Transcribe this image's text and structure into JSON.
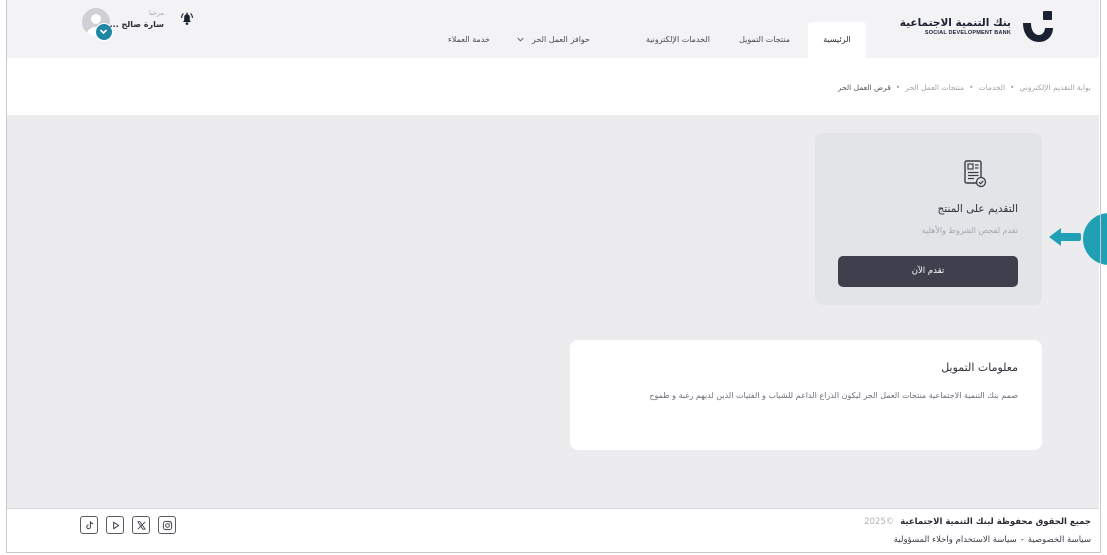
{
  "header": {
    "logo": {
      "title": "بنك التنمية الاجتماعية",
      "subtitle": "SOCIAL DEVELOPMENT BANK",
      "icon": "sdb-logo-icon"
    },
    "nav": [
      {
        "label": "الرئيسية",
        "active": true
      },
      {
        "label": "منتجات التمويل",
        "active": false
      },
      {
        "label": "الخدمات الإلكترونية",
        "active": false
      },
      {
        "label": "حوافز العمل الحر",
        "active": false,
        "has_dropdown": true
      },
      {
        "label": "خدمة العملاء",
        "active": false
      }
    ],
    "user": {
      "greeting": "مرحبا",
      "name": "سارة صالح ...",
      "avatar_icon": "user-avatar-icon",
      "badge_icon": "chevron-down-icon"
    },
    "notifications_icon": "bell-icon"
  },
  "breadcrumb": {
    "items": [
      "بوابة التقديم الإلكتروني",
      "الخدمات",
      "منتجات العمل الحر",
      "قرض العمل الحر"
    ],
    "separator": "•"
  },
  "apply_card": {
    "icon": "application-form-icon",
    "title": "التقديم على المنتج",
    "subtitle": "تقدم لفحص الشروط والأهلية",
    "button_label": "تقدم الآن"
  },
  "info_card": {
    "title": "معلومات التمويل",
    "body": "صمم بنك التنمية الاجتماعية منتجات العمل الحر ليكون الذراع الداعم للشباب و الفتيات الذين لديهم رغبة و طموح"
  },
  "footer": {
    "copyright": "جميع الحقوق محفوظة لبنك التنمية الاجتماعية",
    "year": "2025©",
    "policy_links": [
      "سياسة الخصوصية",
      "سياسة الاستخدام واخلاء المسؤولية"
    ],
    "policy_separator": "-",
    "social": [
      "tiktok-icon",
      "youtube-icon",
      "x-icon",
      "instagram-icon"
    ]
  },
  "annotation": {
    "icon": "arrow-left-icon",
    "color": "#1fa0b5"
  },
  "colors": {
    "header_bg": "#f3f3f5",
    "content_bg": "#ececef",
    "card_bg": "#e3e4e8",
    "button_bg": "#3f404e",
    "brand_dark": "#1b2130",
    "accent": "#1f86a6"
  }
}
